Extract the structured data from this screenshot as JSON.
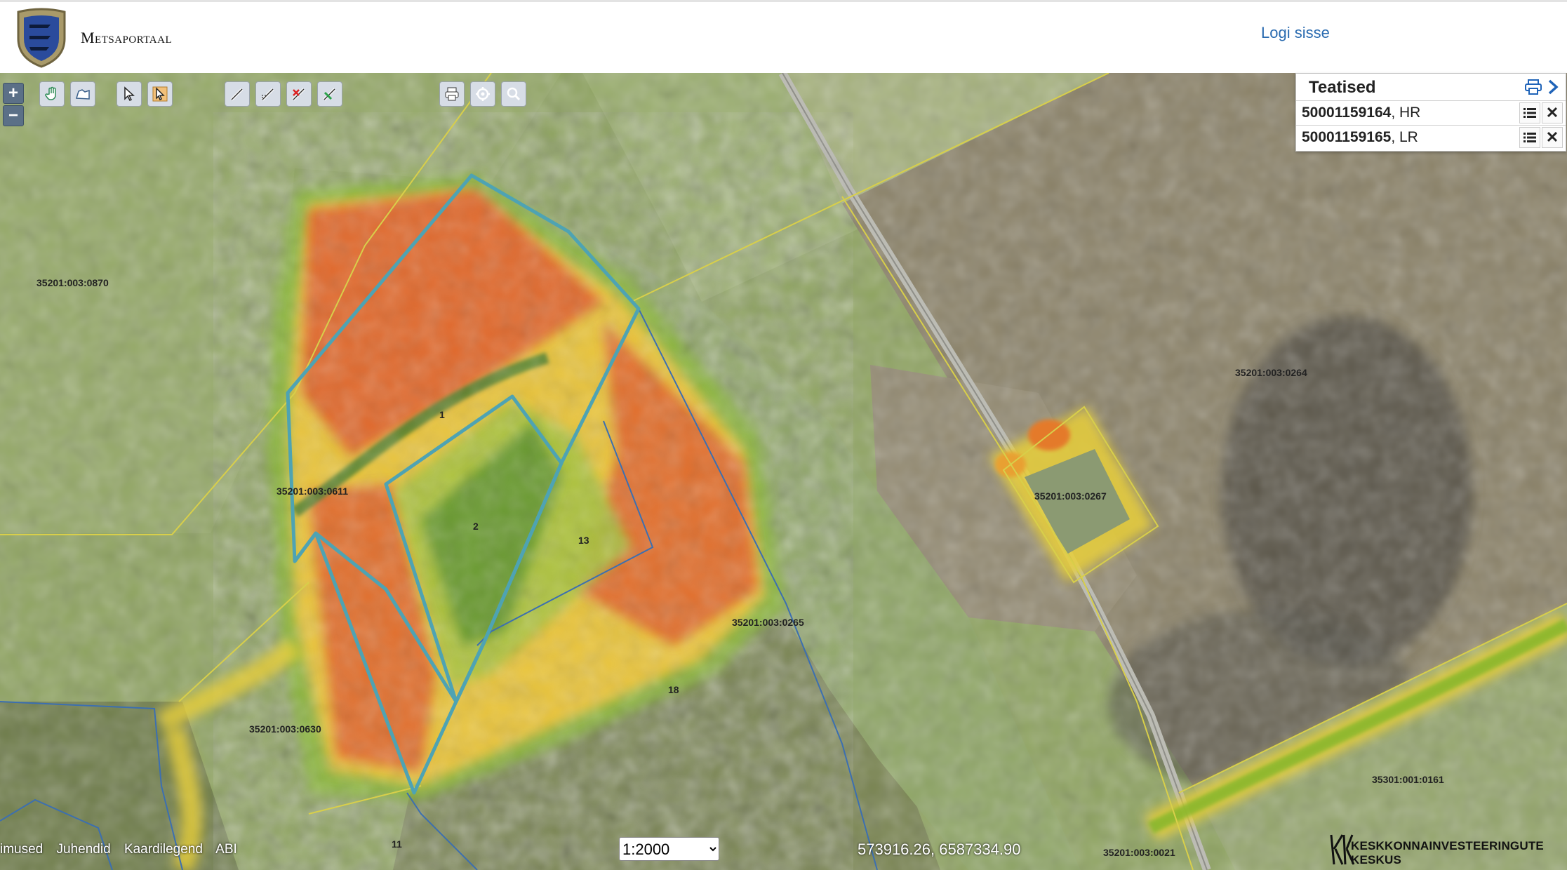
{
  "header": {
    "app_title": "Metsaportaal",
    "login_label": "Logi sisse"
  },
  "toolbar": {
    "zoom_in": "+",
    "zoom_out": "−",
    "buttons": [
      "pan-hand-icon",
      "map-extent-icon",
      "select-pointer-icon",
      "select-identify-icon",
      "draw-line-icon",
      "edit-line-icon",
      "delete-line-icon",
      "measure-icon",
      "print-icon",
      "locate-icon",
      "search-icon"
    ]
  },
  "notices": {
    "title": "Teatised",
    "items": [
      {
        "id": "50001159164",
        "suffix": ", HR"
      },
      {
        "id": "50001159165",
        "suffix": ", LR"
      }
    ]
  },
  "map": {
    "parcels": [
      {
        "label": "35201:003:0870"
      },
      {
        "label": "35201:003:0264"
      },
      {
        "label": "35201:003:0267"
      },
      {
        "label": "35201:003:0265"
      },
      {
        "label": "35201:003:0611"
      },
      {
        "label": "35201:003:0630"
      },
      {
        "label": "35301:001:0161"
      },
      {
        "label": "35201:003:0021"
      }
    ],
    "stands": [
      {
        "label": "1"
      },
      {
        "label": "2"
      },
      {
        "label": "13"
      },
      {
        "label": "18"
      },
      {
        "label": "11"
      }
    ],
    "colors": {
      "notice_outline": "#4ea3b3",
      "cadastral_line": "#d8cf4a",
      "stand_line": "#3c6fb0",
      "heat_high": "#e2502a",
      "heat_mid": "#f0c832",
      "heat_low": "#7fb52c"
    }
  },
  "footer": {
    "links": [
      "imused",
      "Juhendid",
      "Kaardilegend",
      "ABI"
    ],
    "scale": {
      "selected": "1:2000",
      "options": [
        "1:2000"
      ]
    },
    "coordinates": "573916.26, 6587334.90",
    "agency": "KESKKONNAINVESTEERINGUTE KESKUS"
  }
}
